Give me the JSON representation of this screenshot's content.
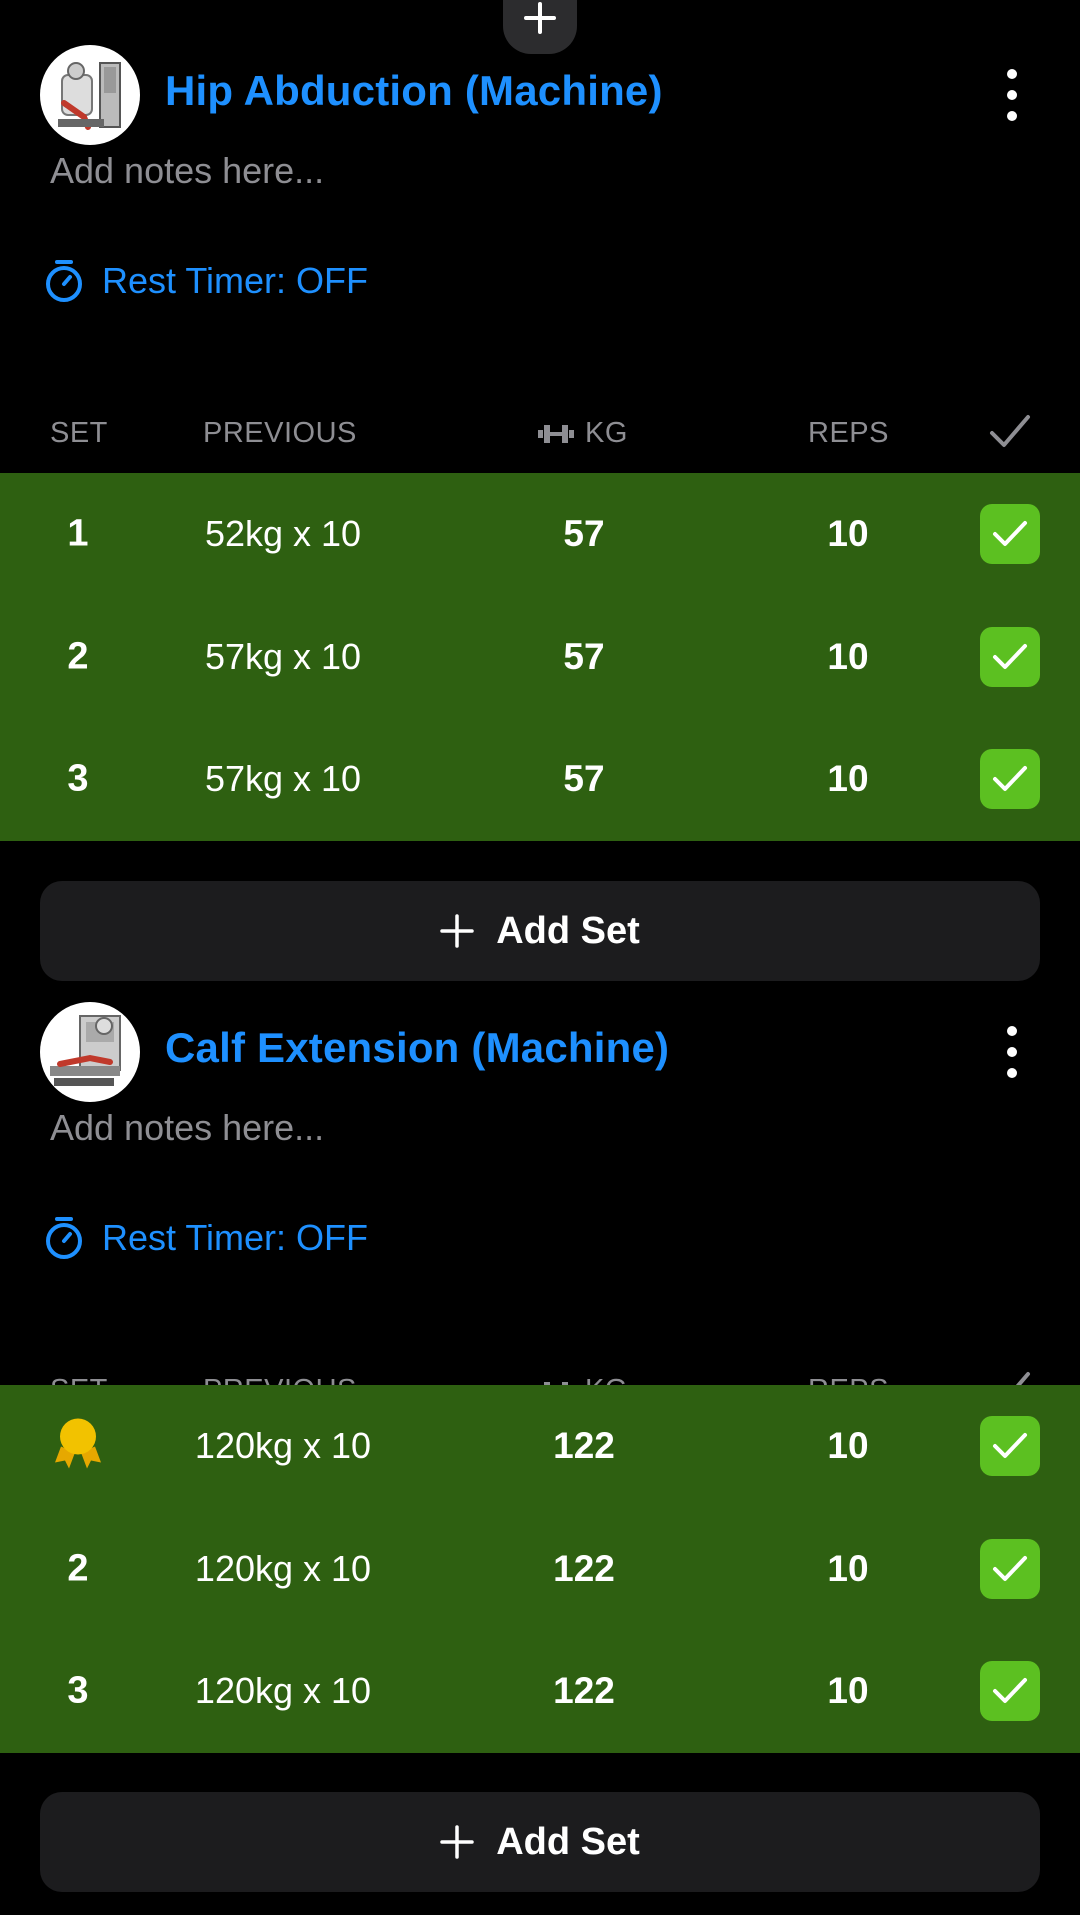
{
  "colors": {
    "accent": "#1e90ff",
    "completed_row": "#2e6011",
    "check_green": "#5cc021",
    "medal_gold": "#f2c200"
  },
  "top_button_icon": "plus-icon",
  "exercises": [
    {
      "title": "Hip Abduction (Machine)",
      "notes_placeholder": "Add notes here...",
      "rest_timer": "Rest Timer: OFF",
      "columns": {
        "set": "SET",
        "previous": "PREVIOUS",
        "kg": "KG",
        "reps": "REPS"
      },
      "sets": [
        {
          "set": "1",
          "previous": "52kg x 10",
          "kg": "57",
          "reps": "10",
          "completed": true
        },
        {
          "set": "2",
          "previous": "57kg x 10",
          "kg": "57",
          "reps": "10",
          "completed": true
        },
        {
          "set": "3",
          "previous": "57kg x 10",
          "kg": "57",
          "reps": "10",
          "completed": true
        }
      ],
      "add_set_label": "Add Set"
    },
    {
      "title": "Calf Extension (Machine)",
      "notes_placeholder": "Add notes here...",
      "rest_timer": "Rest Timer: OFF",
      "columns": {
        "set": "SET",
        "previous": "PREVIOUS",
        "kg": "KG",
        "reps": "REPS"
      },
      "sets": [
        {
          "set": "",
          "set_icon": "medal-icon",
          "previous": "120kg x 10",
          "kg": "122",
          "reps": "10",
          "completed": true
        },
        {
          "set": "2",
          "previous": "120kg x 10",
          "kg": "122",
          "reps": "10",
          "completed": true
        },
        {
          "set": "3",
          "previous": "120kg x 10",
          "kg": "122",
          "reps": "10",
          "completed": true
        }
      ],
      "add_set_label": "Add Set"
    }
  ]
}
